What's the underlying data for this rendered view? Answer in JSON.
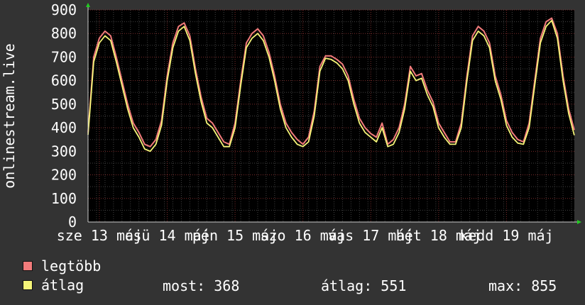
{
  "colors": {
    "background": "#333333",
    "plot_background": "#000000",
    "grid_major": "#7a2a2a",
    "grid_minor": "#404040",
    "axis_text": "#ffffff",
    "series_max": "#f27b7b",
    "series_avg": "#f5f578",
    "axis_arrow": "#22cc22"
  },
  "legend": {
    "max_label": "legtöbb",
    "avg_label": "átlag"
  },
  "stats": {
    "now_label": "most: 368",
    "avg_label": "átlag: 551",
    "max_label": "max: 855"
  },
  "chart_data": {
    "type": "line",
    "ylabel": "onlinestream.live",
    "ylim": [
      0,
      900
    ],
    "yticks": [
      0,
      100,
      200,
      300,
      400,
      500,
      600,
      700,
      800,
      900
    ],
    "x_tick_labels": [
      "sze 13 máj",
      "csü 14 máj",
      "pén 15 máj",
      "szo 16 máj",
      "vas 17 máj",
      "hét 18 máj",
      "kedd 19 máj"
    ],
    "x_start": "2020-05-12 20:00",
    "x_end": "2020-05-20 00:00",
    "grid": true,
    "legend_position": "bottom-left",
    "series": [
      {
        "name": "legtöbb",
        "color": "#f27b7b",
        "times": [
          "05-12 20:00",
          "05-12 22:00",
          "05-13 00:00",
          "05-13 02:00",
          "05-13 04:00",
          "05-13 06:00",
          "05-13 08:00",
          "05-13 10:00",
          "05-13 12:00",
          "05-13 14:00",
          "05-13 16:00",
          "05-13 18:00",
          "05-13 20:00",
          "05-13 22:00",
          "05-14 00:00",
          "05-14 02:00",
          "05-14 04:00",
          "05-14 06:00",
          "05-14 08:00",
          "05-14 10:00",
          "05-14 12:00",
          "05-14 14:00",
          "05-14 16:00",
          "05-14 18:00",
          "05-14 20:00",
          "05-14 22:00",
          "05-15 00:00",
          "05-15 02:00",
          "05-15 04:00",
          "05-15 06:00",
          "05-15 08:00",
          "05-15 10:00",
          "05-15 12:00",
          "05-15 14:00",
          "05-15 16:00",
          "05-15 18:00",
          "05-15 20:00",
          "05-15 22:00",
          "05-16 00:00",
          "05-16 02:00",
          "05-16 04:00",
          "05-16 06:00",
          "05-16 08:00",
          "05-16 10:00",
          "05-16 12:00",
          "05-16 14:00",
          "05-16 16:00",
          "05-16 18:00",
          "05-16 20:00",
          "05-16 22:00",
          "05-17 00:00",
          "05-17 02:00",
          "05-17 04:00",
          "05-17 06:00",
          "05-17 08:00",
          "05-17 10:00",
          "05-17 12:00",
          "05-17 14:00",
          "05-17 16:00",
          "05-17 18:00",
          "05-17 20:00",
          "05-17 22:00",
          "05-18 00:00",
          "05-18 02:00",
          "05-18 04:00",
          "05-18 06:00",
          "05-18 08:00",
          "05-18 10:00",
          "05-18 12:00",
          "05-18 14:00",
          "05-18 16:00",
          "05-18 18:00",
          "05-18 20:00",
          "05-18 22:00",
          "05-19 00:00",
          "05-19 02:00",
          "05-19 04:00",
          "05-19 06:00",
          "05-19 08:00",
          "05-19 10:00",
          "05-19 12:00",
          "05-19 14:00",
          "05-19 16:00",
          "05-19 18:00",
          "05-19 20:00",
          "05-19 22:00",
          "05-19 23:59"
        ],
        "values": [
          380,
          700,
          780,
          810,
          790,
          700,
          600,
          500,
          420,
          380,
          330,
          320,
          350,
          430,
          620,
          760,
          830,
          845,
          790,
          650,
          530,
          440,
          420,
          380,
          340,
          330,
          420,
          600,
          760,
          800,
          820,
          790,
          720,
          620,
          500,
          420,
          380,
          350,
          330,
          360,
          470,
          660,
          705,
          705,
          690,
          670,
          620,
          520,
          440,
          400,
          375,
          360,
          420,
          330,
          350,
          400,
          500,
          660,
          620,
          630,
          560,
          510,
          420,
          380,
          340,
          340,
          420,
          620,
          790,
          830,
          810,
          760,
          620,
          540,
          430,
          380,
          350,
          340,
          420,
          600,
          780,
          850,
          865,
          800,
          620,
          480,
          390
        ]
      },
      {
        "name": "átlag",
        "color": "#f5f578",
        "times": [
          "05-12 20:00",
          "05-12 22:00",
          "05-13 00:00",
          "05-13 02:00",
          "05-13 04:00",
          "05-13 06:00",
          "05-13 08:00",
          "05-13 10:00",
          "05-13 12:00",
          "05-13 14:00",
          "05-13 16:00",
          "05-13 18:00",
          "05-13 20:00",
          "05-13 22:00",
          "05-14 00:00",
          "05-14 02:00",
          "05-14 04:00",
          "05-14 06:00",
          "05-14 08:00",
          "05-14 10:00",
          "05-14 12:00",
          "05-14 14:00",
          "05-14 16:00",
          "05-14 18:00",
          "05-14 20:00",
          "05-14 22:00",
          "05-15 00:00",
          "05-15 02:00",
          "05-15 04:00",
          "05-15 06:00",
          "05-15 08:00",
          "05-15 10:00",
          "05-15 12:00",
          "05-15 14:00",
          "05-15 16:00",
          "05-15 18:00",
          "05-15 20:00",
          "05-15 22:00",
          "05-16 00:00",
          "05-16 02:00",
          "05-16 04:00",
          "05-16 06:00",
          "05-16 08:00",
          "05-16 10:00",
          "05-16 12:00",
          "05-16 14:00",
          "05-16 16:00",
          "05-16 18:00",
          "05-16 20:00",
          "05-16 22:00",
          "05-17 00:00",
          "05-17 02:00",
          "05-17 04:00",
          "05-17 06:00",
          "05-17 08:00",
          "05-17 10:00",
          "05-17 12:00",
          "05-17 14:00",
          "05-17 16:00",
          "05-17 18:00",
          "05-17 20:00",
          "05-17 22:00",
          "05-18 00:00",
          "05-18 02:00",
          "05-18 04:00",
          "05-18 06:00",
          "05-18 08:00",
          "05-18 10:00",
          "05-18 12:00",
          "05-18 14:00",
          "05-18 16:00",
          "05-18 18:00",
          "05-18 20:00",
          "05-18 22:00",
          "05-19 00:00",
          "05-19 02:00",
          "05-19 04:00",
          "05-19 06:00",
          "05-19 08:00",
          "05-19 10:00",
          "05-19 12:00",
          "05-19 14:00",
          "05-19 16:00",
          "05-19 18:00",
          "05-19 20:00",
          "05-19 22:00",
          "05-19 23:59"
        ],
        "values": [
          370,
          680,
          760,
          790,
          770,
          680,
          580,
          480,
          400,
          360,
          310,
          300,
          330,
          410,
          600,
          740,
          810,
          830,
          770,
          630,
          510,
          420,
          400,
          360,
          320,
          320,
          400,
          580,
          740,
          780,
          800,
          770,
          700,
          600,
          480,
          400,
          360,
          330,
          320,
          340,
          450,
          640,
          695,
          690,
          675,
          650,
          600,
          500,
          420,
          380,
          360,
          340,
          400,
          320,
          330,
          380,
          480,
          640,
          600,
          610,
          540,
          490,
          400,
          360,
          330,
          330,
          400,
          600,
          770,
          810,
          790,
          740,
          600,
          520,
          410,
          360,
          335,
          330,
          400,
          580,
          760,
          830,
          855,
          780,
          600,
          460,
          368
        ]
      }
    ]
  }
}
